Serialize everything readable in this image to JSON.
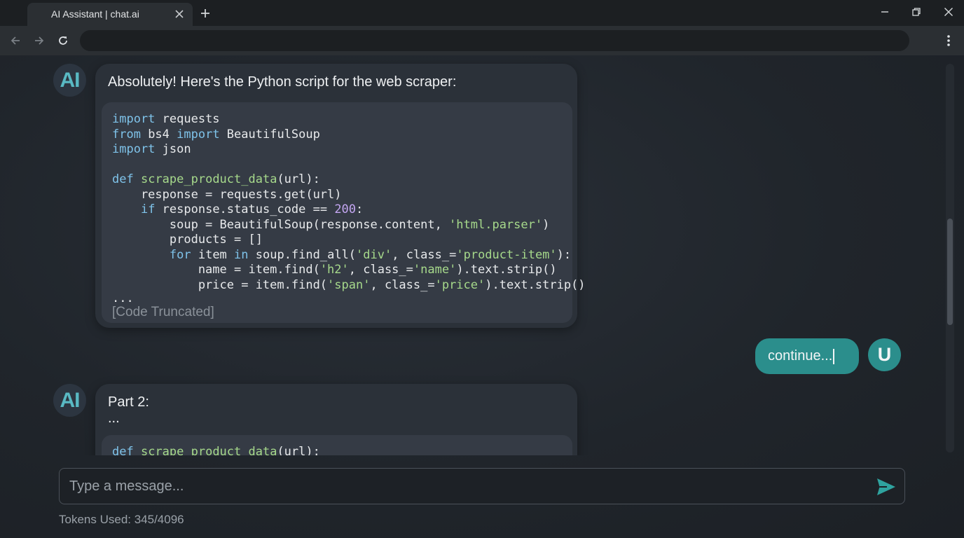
{
  "browser": {
    "tab_title": "AI Assistant | chat.ai",
    "address": "",
    "icons": {
      "close": "close-icon",
      "new_tab": "plus-icon",
      "back": "arrow-left-icon",
      "forward": "arrow-right-icon",
      "reload": "reload-icon",
      "menu": "kebab-menu-icon",
      "minimize": "minimize-icon",
      "restore": "restore-icon",
      "window_close": "close-icon"
    }
  },
  "chat": {
    "ai_avatar_label": "AI",
    "user_avatar_label": "U",
    "messages": [
      {
        "role": "assistant",
        "text": "Absolutely! Here's the Python script for the web scraper:",
        "code_truncated_label": "[Code Truncated]"
      },
      {
        "role": "user",
        "text": "continue..."
      },
      {
        "role": "assistant",
        "text": "Part 2:",
        "text_line2": "...",
        "code_first_line": "def scrape_product_data(url):"
      }
    ]
  },
  "composer": {
    "placeholder": "Type a message...",
    "send_icon": "send-icon"
  },
  "tokens": {
    "label": "Tokens Used: 345/4096"
  },
  "colors": {
    "accent": "#2b8e8c",
    "ai_avatar_text": "#59b9c3",
    "keyword": "#7fc3ea",
    "string": "#a6d98b",
    "number": "#c4a6f2"
  }
}
